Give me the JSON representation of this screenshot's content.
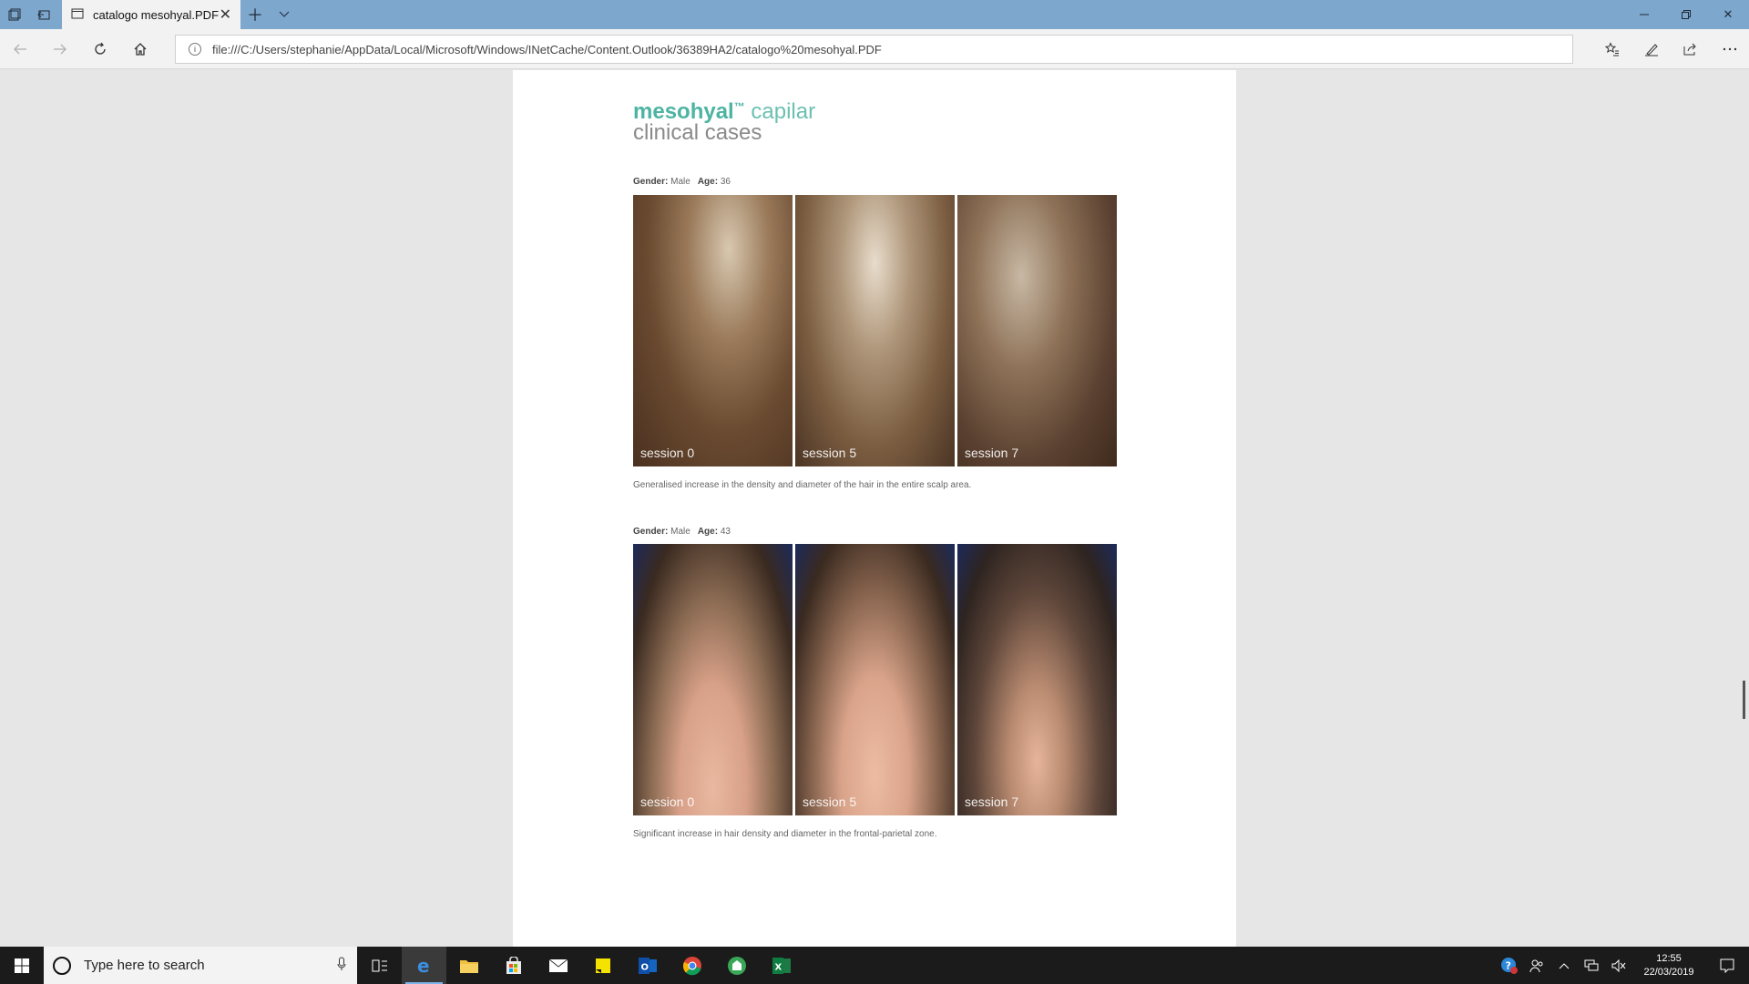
{
  "browser": {
    "tab_title": "catalogo mesohyal.PDF",
    "url": "file:///C:/Users/stephanie/AppData/Local/Microsoft/Windows/INetCache/Content.Outlook/36389HA2/catalogo%20mesohyal.PDF"
  },
  "document": {
    "brand": "mesohyal",
    "trademark": "™",
    "brand_suffix": "capilar",
    "subtitle": "clinical cases",
    "cases": [
      {
        "gender_label": "Gender:",
        "gender": "Male",
        "age_label": "Age:",
        "age": "36",
        "photos": [
          "session 0",
          "session 5",
          "session 7"
        ],
        "caption": "Generalised increase in the density and diameter of the hair in the entire scalp area."
      },
      {
        "gender_label": "Gender:",
        "gender": "Male",
        "age_label": "Age:",
        "age": "43",
        "photos": [
          "session 0",
          "session 5",
          "session 7"
        ],
        "caption": "Significant increase in hair density and diameter in the frontal-parietal zone."
      }
    ]
  },
  "taskbar": {
    "search_placeholder": "Type here to search",
    "time": "12:55",
    "date": "22/03/2019"
  },
  "icons": {
    "tab_actions": "tab-actions-icon",
    "set_aside": "set-aside-tabs-icon",
    "page": "page-icon",
    "close": "close-icon",
    "new_tab": "plus-icon",
    "tab_preview": "chevron-down-icon",
    "minimize": "minimize-icon",
    "restore": "restore-icon",
    "back": "arrow-left-icon",
    "forward": "arrow-right-icon",
    "refresh": "refresh-icon",
    "home": "home-icon",
    "info": "info-icon",
    "favorites": "favorites-icon",
    "notes": "pen-icon",
    "share": "share-icon",
    "more": "more-icon"
  }
}
